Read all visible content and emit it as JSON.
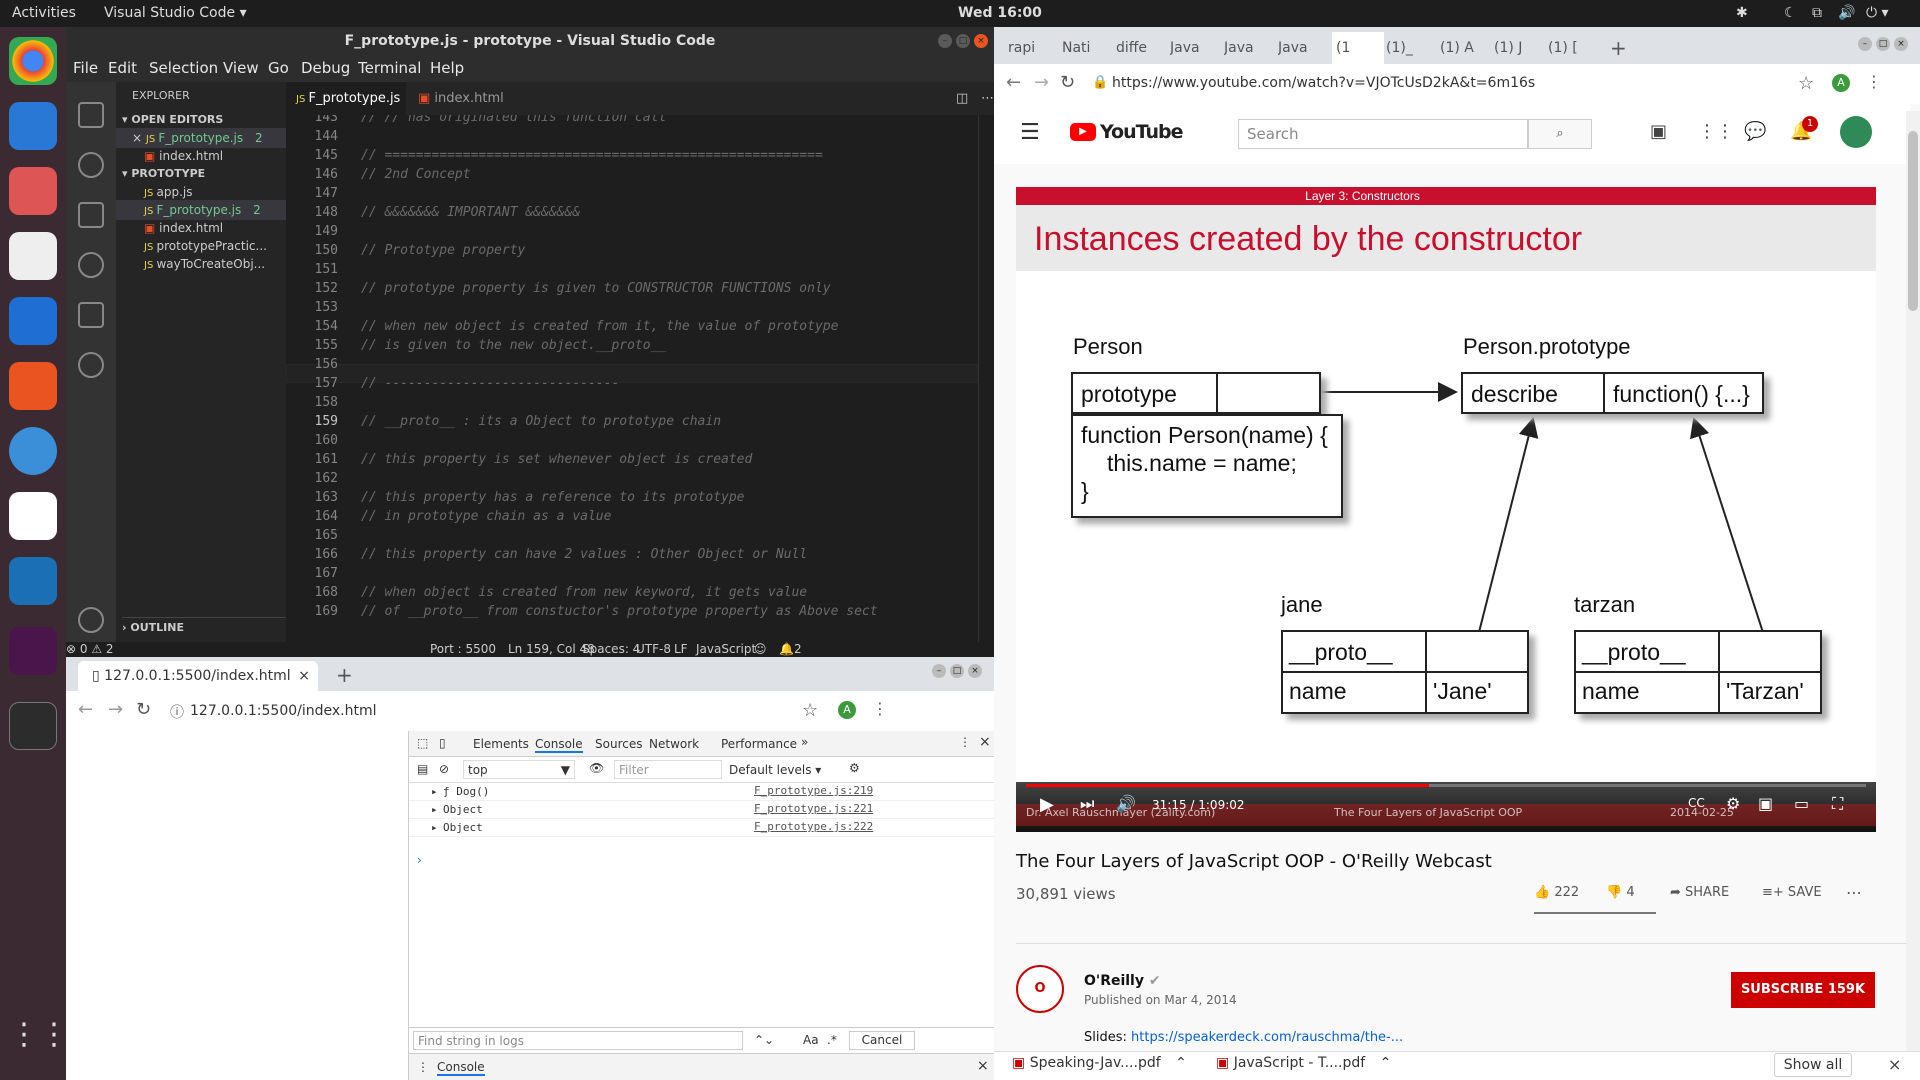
{
  "topbar": {
    "activities": "Activities",
    "app": "Visual Studio Code ▾",
    "clock": "Wed 16:00"
  },
  "vscode": {
    "title": "F_prototype.js - prototype - Visual Studio Code",
    "menu": [
      "File",
      "Edit",
      "Selection",
      "View",
      "Go",
      "Debug",
      "Terminal",
      "Help"
    ],
    "explorer_label": "EXPLORER",
    "open_editors_label": "OPEN EDITORS",
    "open_editors": [
      {
        "name": "F_prototype.js",
        "badge": "2"
      },
      {
        "name": "index.html",
        "badge": ""
      }
    ],
    "folder_label": "PROTOTYPE",
    "files": [
      {
        "name": "app.js",
        "badge": ""
      },
      {
        "name": "F_prototype.js",
        "badge": "2"
      },
      {
        "name": "index.html",
        "badge": ""
      },
      {
        "name": "prototypePractic...",
        "badge": ""
      },
      {
        "name": "wayToCreateObj...",
        "badge": ""
      }
    ],
    "outline_label": "OUTLINE",
    "tabs": [
      {
        "label": "F_prototype.js"
      },
      {
        "label": "index.html"
      }
    ],
    "lines": [
      {
        "n": "143",
        "t": "// // has originated this function call"
      },
      {
        "n": "144",
        "t": ""
      },
      {
        "n": "145",
        "t": "// ========================================================"
      },
      {
        "n": "146",
        "t": "// 2nd Concept"
      },
      {
        "n": "147",
        "t": ""
      },
      {
        "n": "148",
        "t": "// &&&&&&& IMPORTANT &&&&&&&"
      },
      {
        "n": "149",
        "t": ""
      },
      {
        "n": "150",
        "t": "// Prototype property"
      },
      {
        "n": "151",
        "t": ""
      },
      {
        "n": "152",
        "t": "// prototype property is given to CONSTRUCTOR FUNCTIONS only"
      },
      {
        "n": "153",
        "t": ""
      },
      {
        "n": "154",
        "t": "// when new object is created from it, the value of prototype"
      },
      {
        "n": "155",
        "t": "// is given to the new object.__proto__"
      },
      {
        "n": "156",
        "t": ""
      },
      {
        "n": "157",
        "t": "// ------------------------------"
      },
      {
        "n": "158",
        "t": ""
      },
      {
        "n": "159",
        "t": "// __proto__ : its a Object to prototype chain"
      },
      {
        "n": "160",
        "t": ""
      },
      {
        "n": "161",
        "t": "// this property is set whenever object is created"
      },
      {
        "n": "162",
        "t": ""
      },
      {
        "n": "163",
        "t": "// this property has a reference to its prototype"
      },
      {
        "n": "164",
        "t": "// in prototype chain as a value"
      },
      {
        "n": "165",
        "t": ""
      },
      {
        "n": "166",
        "t": "// this property can have 2 values : Other Object or Null"
      },
      {
        "n": "167",
        "t": ""
      },
      {
        "n": "168",
        "t": "// when object is created from new keyword, it gets value"
      },
      {
        "n": "169",
        "t": "// of __proto__ from constuctor's prototype property as Above sect"
      }
    ],
    "status": {
      "problems": "⊗ 0 ⚠ 2",
      "port": "Port : 5500",
      "pos": "Ln 159, Col 48",
      "spaces": "Spaces: 4",
      "enc": "UTF-8",
      "eol": "LF",
      "lang": "JavaScript",
      "bell": "2"
    }
  },
  "browser_small": {
    "tab_title": "127.0.0.1:5500/index.html",
    "url": "127.0.0.1:5500/index.html",
    "avatar": "A",
    "devtools_tabs": [
      "Elements",
      "Console",
      "Sources",
      "Network",
      "Performance"
    ],
    "context": "top",
    "filter_placeholder": "Filter",
    "levels": "Default levels ▾",
    "logs": [
      {
        "text": "ƒ Dog()",
        "src": "F_prototype.js:219"
      },
      {
        "text": "Object",
        "src": "F_prototype.js:221"
      },
      {
        "text": "Object",
        "src": "F_prototype.js:222"
      }
    ],
    "find_placeholder": "Find string in logs",
    "aa": "Aa",
    "regex": ".*",
    "cancel": "Cancel",
    "drawer_tab": "Console"
  },
  "youtube": {
    "tabs": [
      "rapi",
      "Nati",
      "diffe",
      "Java",
      "Java",
      "Java",
      "(1",
      "(1)_",
      "(1) A",
      "(1) J",
      "(1) ["
    ],
    "url": "https://www.youtube.com/watch?v=VJOTcUsD2kA&t=6m16s",
    "avatar": "A",
    "logo": "YouTube",
    "search_placeholder": "Search",
    "notif": "1",
    "slide": {
      "header": "Layer 3: Constructors",
      "title": "Instances created by the constructor",
      "person": "Person",
      "person_proto": "Person.prototype",
      "prototype": "prototype",
      "describe": "describe",
      "function_val": "function() {...}",
      "fn_l1": "function Person(name) {",
      "fn_l2": "this.name = name;",
      "fn_l3": "}",
      "jane": "jane",
      "tarzan": "tarzan",
      "proto": "__proto__",
      "name": "name",
      "jane_val": "'Jane'",
      "tarzan_val": "'Tarzan'",
      "footer_left": "Dr. Axel Rauschmayer (2ality.com)",
      "footer_mid": "The Four Layers of JavaScript OOP",
      "footer_right": "2014-02-25"
    },
    "progress": 0.48,
    "time": "31:15 / 1:09:02",
    "video_title": "The Four Layers of JavaScript OOP - O'Reilly Webcast",
    "views": "30,891 views",
    "likes": "222",
    "dislikes": "4",
    "share": "SHARE",
    "save": "SAVE",
    "channel": "O'Reilly",
    "published": "Published on Mar 4, 2014",
    "subscribe": "SUBSCRIBE",
    "subs": "159K",
    "slides_label": "Slides:",
    "slides_link": "https://speakerdeck.com/rauschma/the-...",
    "downloads": [
      "Speaking-Jav....pdf",
      "JavaScript - T....pdf"
    ],
    "show_all": "Show all"
  }
}
